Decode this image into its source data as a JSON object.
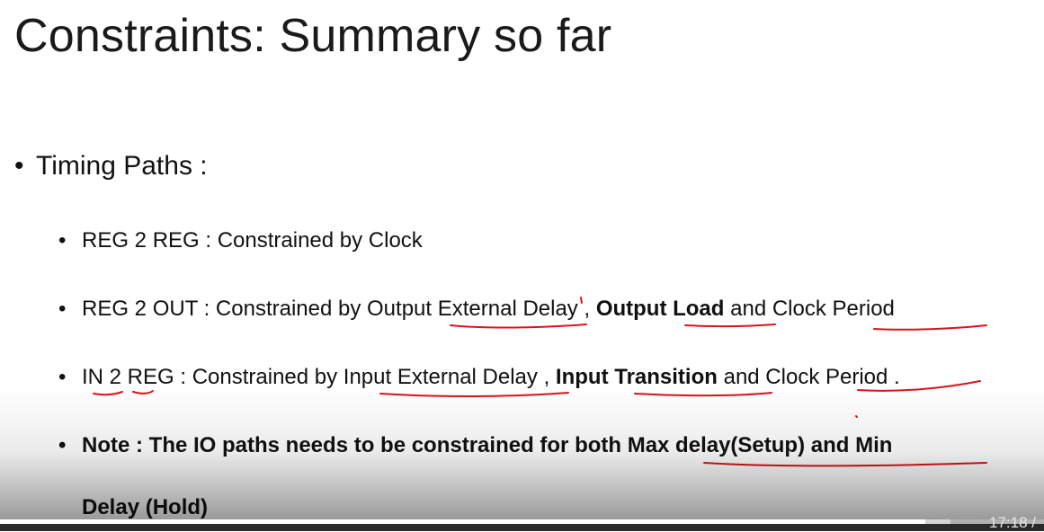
{
  "slide": {
    "title": "Constraints: Summary so far",
    "heading": {
      "bullet": "•",
      "text": "Timing Paths :"
    },
    "items": [
      {
        "bullet": "•",
        "text": "REG 2 REG : Constrained by Clock"
      },
      {
        "bullet": "•",
        "pre": "REG 2 OUT : Constrained by Output External Delay , ",
        "bold": "Output Load",
        "post": " and Clock Period"
      },
      {
        "bullet": "•",
        "pre": "IN 2 REG : Constrained by Input External Delay , ",
        "bold": "Input Transition",
        "post": " and Clock Period ."
      },
      {
        "bullet": "•",
        "line1": "Note :  The IO paths needs to be constrained for both Max delay(Setup) and Min",
        "line2": "Delay (Hold)"
      }
    ]
  },
  "player": {
    "time": "17:18 /",
    "progress_percent": 88.6,
    "buffered_percent": 91
  },
  "colors": {
    "annotation": "#d8141c",
    "text": "#111111",
    "background": "#ffffff"
  }
}
